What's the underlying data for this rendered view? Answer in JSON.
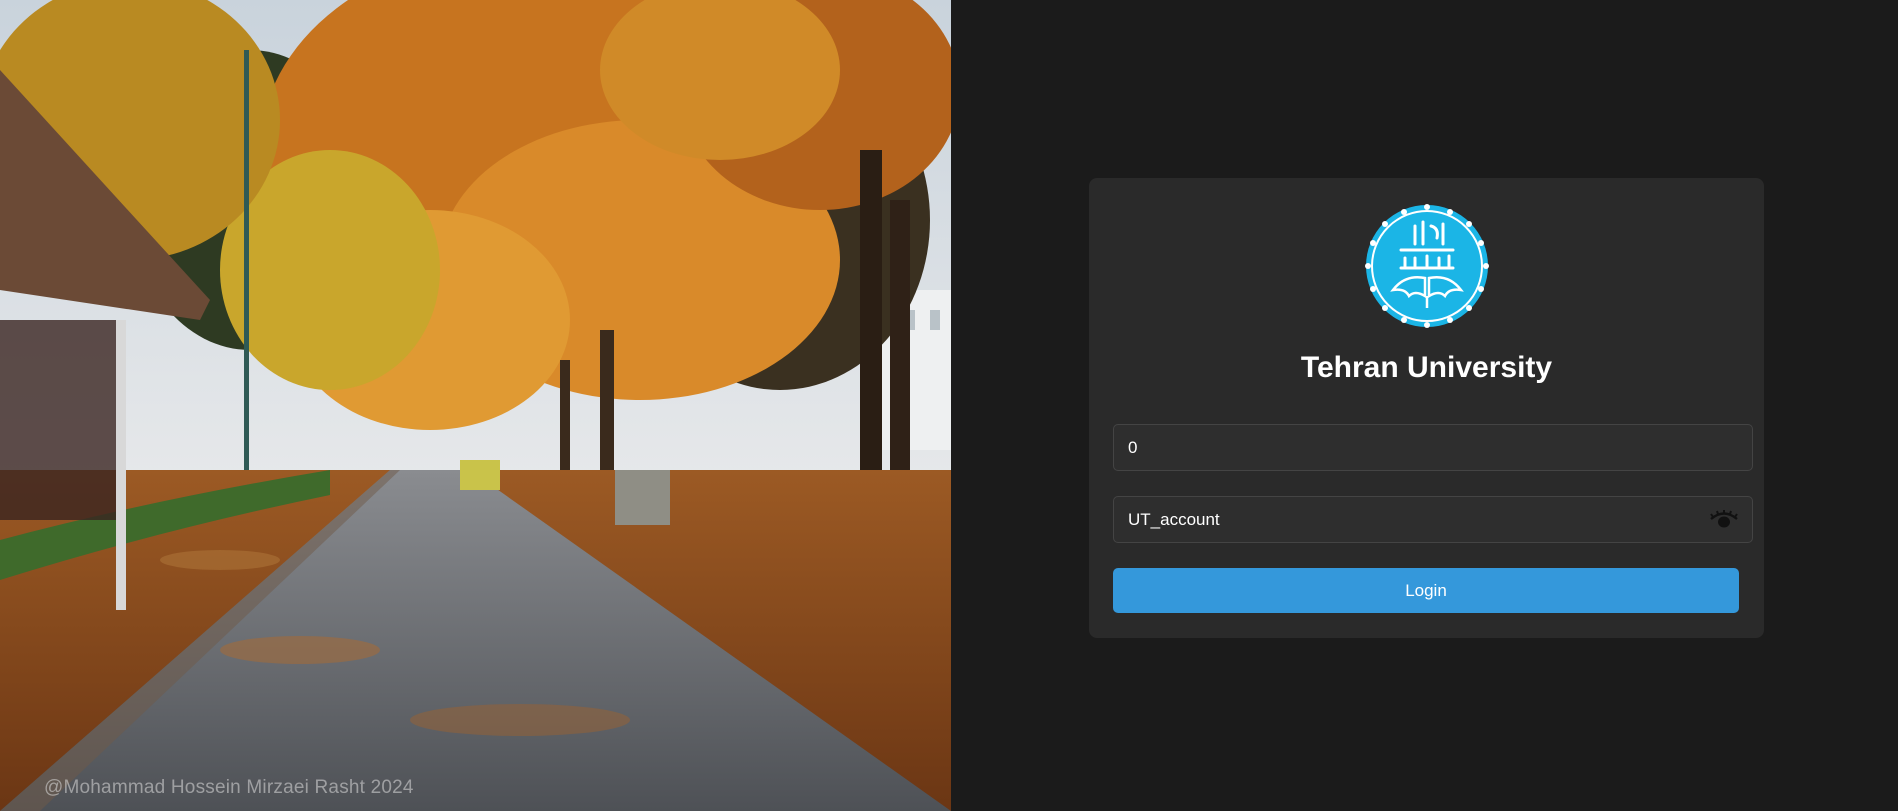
{
  "photo": {
    "credit": "@Mohammad Hossein Mirzaei Rasht 2024"
  },
  "login_card": {
    "logo_icon": "university-of-tehran-seal",
    "title": "Tehran University",
    "username": {
      "value": "0"
    },
    "password": {
      "value": "UT_account",
      "toggle_icon": "eye-icon"
    },
    "login_label": "Login"
  },
  "colors": {
    "background": "#1b1b1b",
    "card": "#2a2a2a",
    "field": "#2e2e2e",
    "button": "#3498db",
    "logo": "#1bb5e6"
  }
}
